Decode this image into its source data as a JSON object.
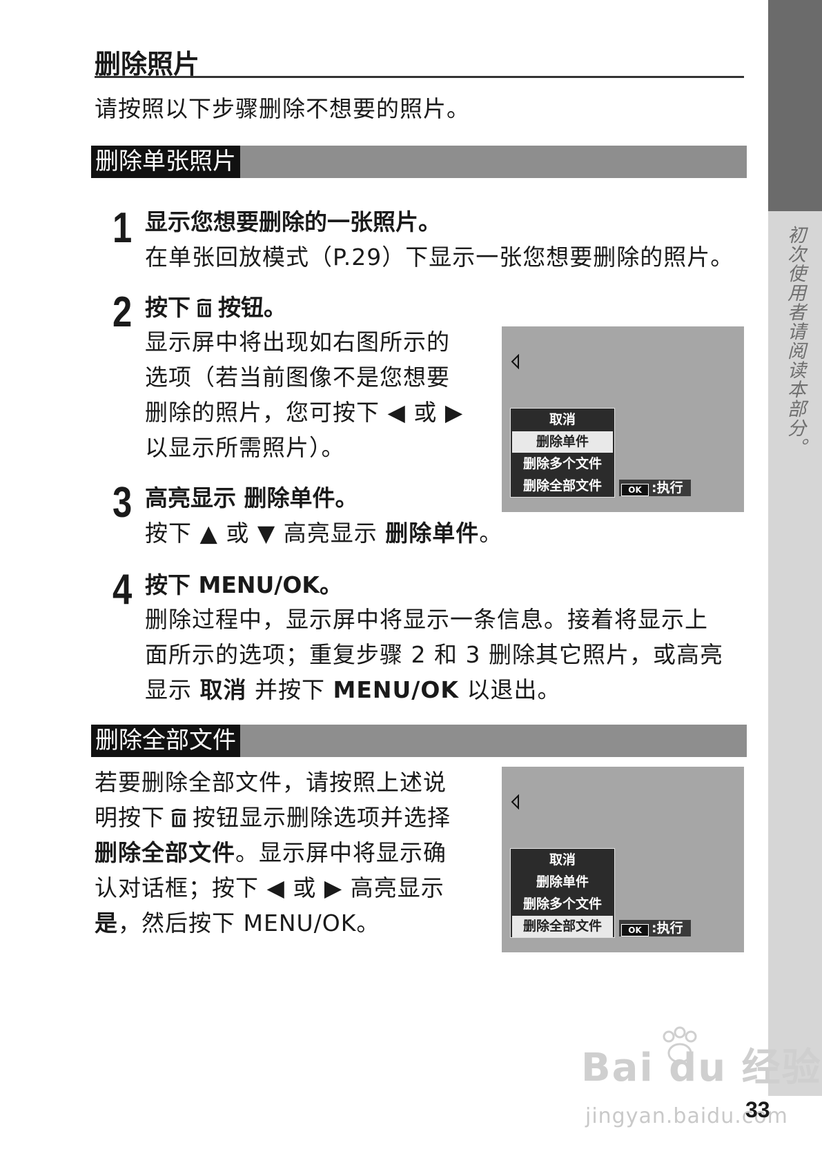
{
  "side_tab": "初次使用者请阅读本部分。",
  "title": "删除照片",
  "intro": "请按照以下步骤删除不想要的照片。",
  "section1": {
    "label": "删除单张照片"
  },
  "steps": [
    {
      "num": "1",
      "head": "显示您想要删除的一张照片。",
      "body": "在单张回放模式（P.29）下显示一张您想要删除的照片。"
    },
    {
      "num": "2",
      "head_a": "按下",
      "head_b": "按钮。",
      "body_lines": [
        "显示屏中将出现如右图所示的",
        "选项（若当前图像不是您想要",
        "删除的照片，您可按下 ◀ 或 ▶",
        "以显示所需照片）。"
      ]
    },
    {
      "num": "3",
      "head": "高亮显示 删除单件。",
      "body_a": "按下 ▲ 或 ▼ 高亮显示 ",
      "body_bold": "删除单件",
      "body_b": "。"
    },
    {
      "num": "4",
      "head": "按下 MENU/OK。",
      "body_line1": "删除过程中，显示屏中将显示一条信息。接着将显示上",
      "body_line2": "面所示的选项；重复步骤 2 和 3 删除其它照片，或高亮",
      "body_line3_a": "显示 ",
      "body_line3_b1": "取消",
      "body_line3_c": " 并按下 ",
      "body_line3_b2": "MENU/OK",
      "body_line3_d": " 以退出。"
    }
  ],
  "section2": {
    "label": "删除全部文件"
  },
  "delete_all": {
    "line1": "若要删除全部文件，请按照上述说",
    "line2_a": "明按下",
    "line2_b": "按钮显示删除选项并选择",
    "line3_bold": "删除全部文件",
    "line3_rest": "。显示屏中将显示确",
    "line4": "认对话框；按下 ◀ 或 ▶ 高亮显示",
    "line5_bold": "是",
    "line5_rest": "，然后按下 MENU/OK。"
  },
  "screen_menu": {
    "items": [
      "取消",
      "删除单件",
      "删除多个文件",
      "删除全部文件"
    ],
    "ok_label": "OK",
    "exec_label": ":执行"
  },
  "screen1": {
    "selected_index": 1
  },
  "screen2": {
    "selected_index": 3
  },
  "watermark": {
    "brand": "Bai du 经验",
    "url": "jingyan.baidu.com"
  },
  "page_number": "33"
}
